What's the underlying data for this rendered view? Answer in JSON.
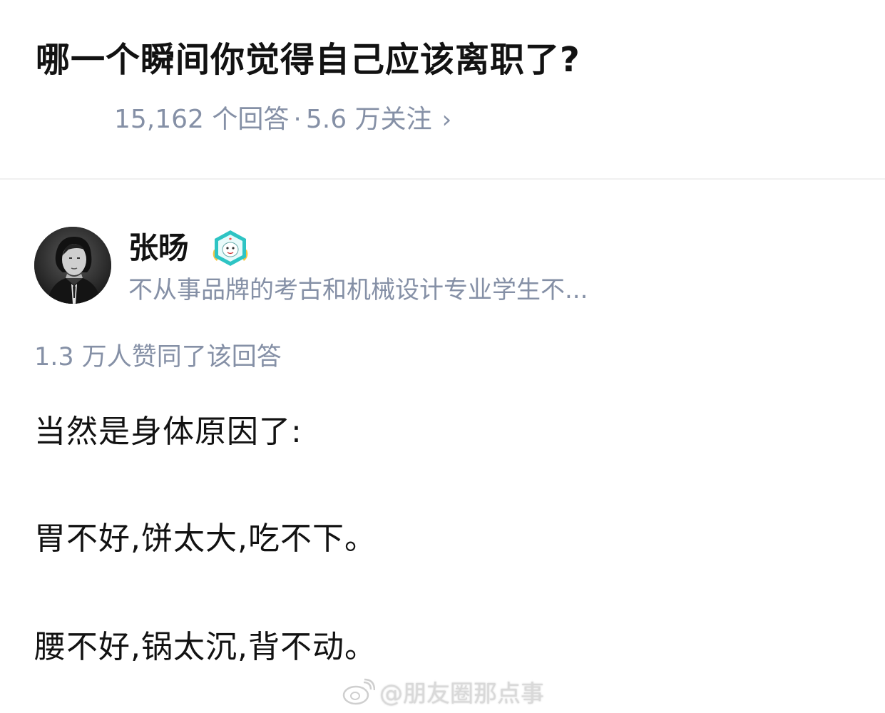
{
  "question": {
    "title": "哪一个瞬间你觉得自己应该离职了?",
    "answer_count": "15,162 个回答",
    "separator": "·",
    "follow_count": "5.6 万关注",
    "chevron": "›"
  },
  "author": {
    "name": "张旸",
    "bio": "不从事品牌的考古和机械设计专业学生不...",
    "avatar_icon": "avatar-photo",
    "badge_icon": "badge-icon"
  },
  "answer": {
    "votes": "1.3 万人赞同了该回答",
    "lines": [
      "当然是身体原因了:",
      "胃不好,饼太大,吃不下。",
      "腰不好,锅太沉,背不动。"
    ]
  },
  "watermark": {
    "text": "@朋友圈那点事",
    "icon": "weibo-icon"
  },
  "colors": {
    "primary_text": "#121212",
    "secondary_text": "#8590a6",
    "divider": "#f0f0f0",
    "badge_teal": "#2ec4c4",
    "badge_yellow": "#f5c542"
  }
}
